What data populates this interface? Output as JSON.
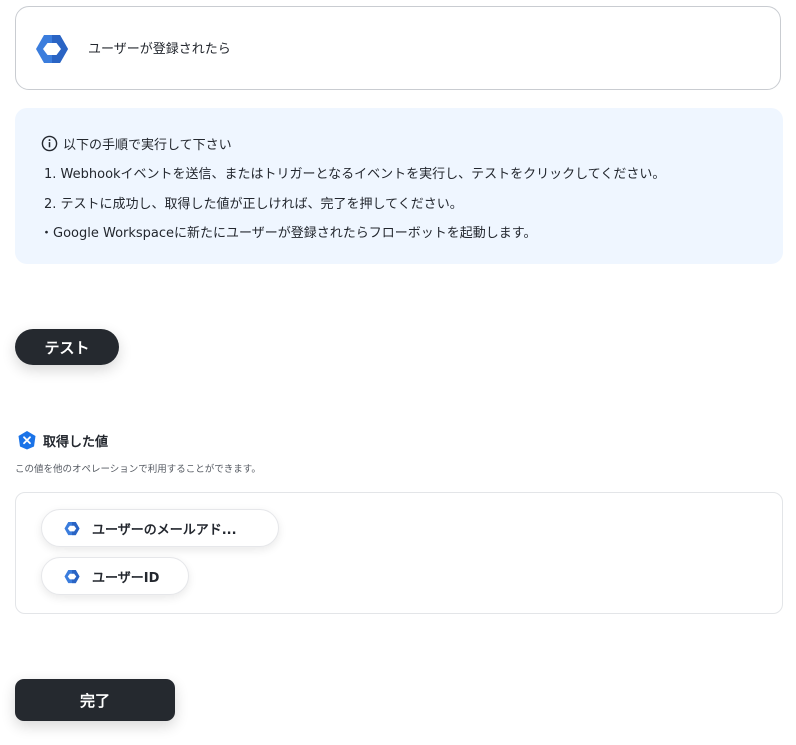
{
  "trigger": {
    "label": "ユーザーが登録されたら",
    "icon": "google-workspace-hexagon-icon"
  },
  "instructions": {
    "title": "以下の手順で実行して下さい",
    "steps": [
      "1. Webhookイベントを送信、またはトリガーとなるイベントを実行し、テストをクリックしてください。",
      "2. テストに成功し、取得した値が正しければ、完了を押してください。"
    ],
    "note": "・Google Workspaceに新たにユーザーが登録されたらフローボットを起動します。"
  },
  "test_button": {
    "label": "テスト"
  },
  "acquired_values": {
    "heading": "取得した値",
    "description": "この値を他のオペレーションで利用することができます。",
    "items": [
      {
        "label": "ユーザーのメールアド..."
      },
      {
        "label": "ユーザーID"
      }
    ]
  },
  "done_button": {
    "label": "完了"
  },
  "colors": {
    "primary_dark": "#25292f",
    "info_background": "#eff6ff",
    "google_blue": "#3b7ddd",
    "badge_blue": "#1a73e8"
  }
}
